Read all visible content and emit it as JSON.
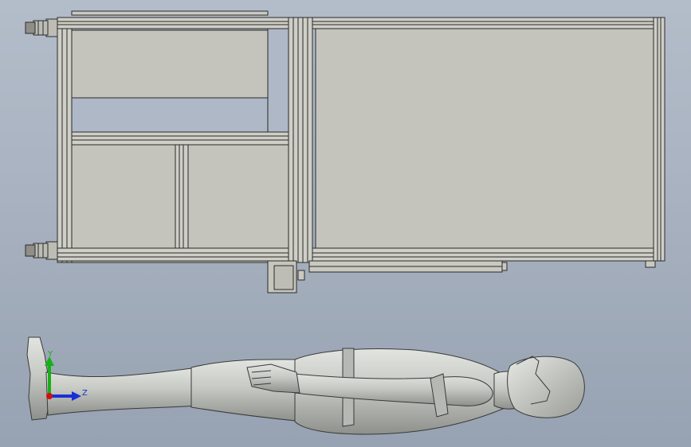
{
  "viewport": {
    "background_top": "#b3bdca",
    "background_bottom": "#97a2b2"
  },
  "model": {
    "frame_color": "#c6c6be",
    "panel_color": "#c4c4bc",
    "edge_color": "#2a2a2a",
    "mannequin_color": "#c9cbc6"
  },
  "triad": {
    "x_axis_color": "#d01010",
    "y_axis_color": "#18b018",
    "z_axis_color": "#1a2fd8",
    "y_label": "Y",
    "z_label": "Z"
  }
}
